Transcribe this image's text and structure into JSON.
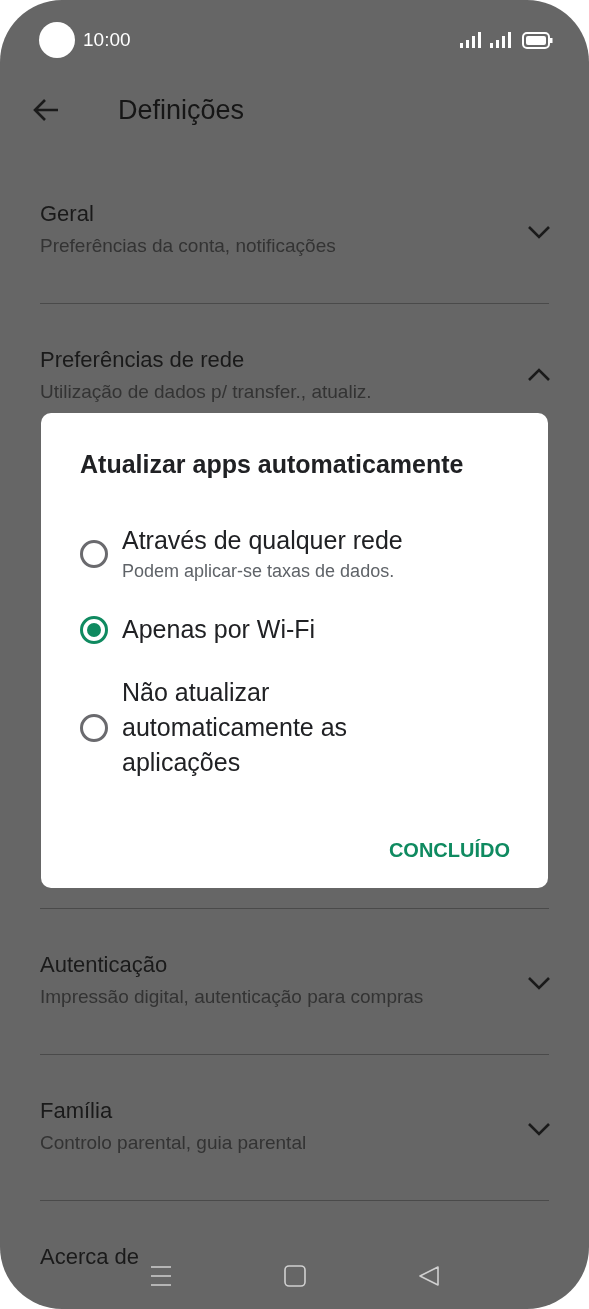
{
  "status_bar": {
    "time": "10:00"
  },
  "header": {
    "title": "Definições"
  },
  "sections": [
    {
      "title": "Geral",
      "subtitle": "Preferências da conta, notificações",
      "expanded": false
    },
    {
      "title": "Preferências de rede",
      "subtitle": "Utilização de dados p/ transfer., atualiz.",
      "expanded": true
    },
    {
      "title": "Autenticação",
      "subtitle": "Impressão digital, autenticação para compras",
      "expanded": false
    },
    {
      "title": "Família",
      "subtitle": "Controlo parental, guia parental",
      "expanded": false
    },
    {
      "title": "Acerca de"
    }
  ],
  "dialog": {
    "title": "Atualizar apps automaticamente",
    "options": [
      {
        "label": "Através de qualquer rede",
        "note": "Podem aplicar-se taxas de dados.",
        "selected": false
      },
      {
        "label": "Apenas por Wi-Fi",
        "selected": true
      },
      {
        "label": "Não atualizar automaticamente as aplicações",
        "selected": false
      }
    ],
    "button": "CONCLUÍDO"
  }
}
